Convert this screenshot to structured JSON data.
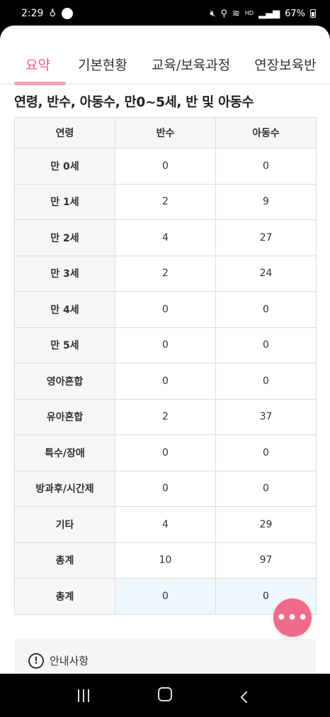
{
  "status_bar": {
    "time": "2:29",
    "icons": [
      "alarm-icon",
      "app-icon",
      "mute-icon",
      "location-icon",
      "wifi-icon",
      "hd-voice-icon",
      "signal-icon"
    ],
    "battery": "67%"
  },
  "tabs": [
    {
      "label": "요약",
      "active": true
    },
    {
      "label": "기본현황",
      "active": false
    },
    {
      "label": "교육/보육과정",
      "active": false
    },
    {
      "label": "연장보육반",
      "active": false
    }
  ],
  "section_title": "연령, 반수, 아동수, 만0~5세, 반 및 아동수",
  "table": {
    "headers": [
      "연령",
      "반수",
      "아동수"
    ],
    "rows": [
      {
        "age": "만 0세",
        "classes": "0",
        "children": "0"
      },
      {
        "age": "만 1세",
        "classes": "2",
        "children": "9"
      },
      {
        "age": "만 2세",
        "classes": "4",
        "children": "27"
      },
      {
        "age": "만 3세",
        "classes": "2",
        "children": "24"
      },
      {
        "age": "만 4세",
        "classes": "0",
        "children": "0"
      },
      {
        "age": "만 5세",
        "classes": "0",
        "children": "0"
      },
      {
        "age": "영아혼합",
        "classes": "0",
        "children": "0"
      },
      {
        "age": "유아혼합",
        "classes": "2",
        "children": "37"
      },
      {
        "age": "특수/장애",
        "classes": "0",
        "children": "0"
      },
      {
        "age": "방과후/시간제",
        "classes": "0",
        "children": "0"
      },
      {
        "age": "기타",
        "classes": "4",
        "children": "29"
      },
      {
        "age": "총계",
        "classes": "10",
        "children": "97"
      },
      {
        "age": "총계",
        "classes": "0",
        "children": "0"
      }
    ]
  },
  "notice": {
    "label": "안내사항",
    "icon": "info-icon"
  },
  "fab": {
    "label": "•••",
    "icon": "more-icon"
  },
  "colors": {
    "accent": "#ef5f7f",
    "fab": "#f06b8a",
    "highlight": "#eef7fc"
  }
}
